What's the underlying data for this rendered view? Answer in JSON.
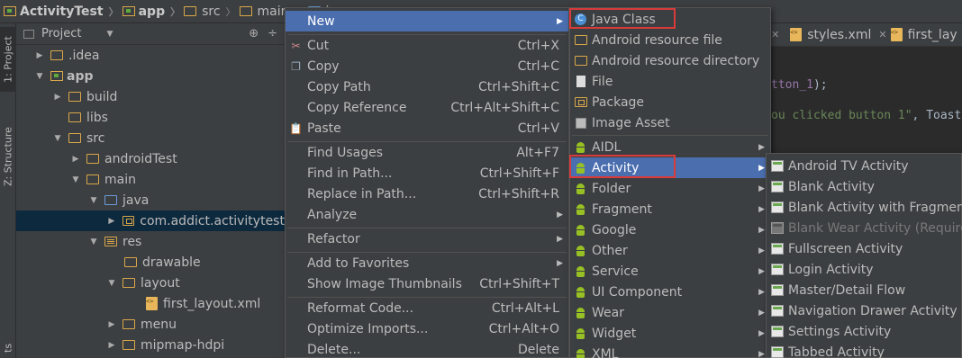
{
  "breadcrumb": [
    "ActivityTest",
    "app",
    "src",
    "main",
    "ja"
  ],
  "sidebar_tabs": {
    "project": "1: Project",
    "structure": "Z: Structure",
    "extra": "ts"
  },
  "project_panel": {
    "view_label": "Project",
    "tree": [
      {
        "label": ".idea"
      },
      {
        "label": "app"
      },
      {
        "label": "build"
      },
      {
        "label": "libs"
      },
      {
        "label": "src"
      },
      {
        "label": "androidTest"
      },
      {
        "label": "main"
      },
      {
        "label": "java"
      },
      {
        "label": "com.addict.activitytest"
      },
      {
        "label": "res"
      },
      {
        "label": "drawable"
      },
      {
        "label": "layout"
      },
      {
        "label": "first_layout.xml"
      },
      {
        "label": "menu"
      },
      {
        "label": "mipmap-hdpi"
      }
    ]
  },
  "editor": {
    "tabs": [
      "styles.xml",
      "first_lay"
    ],
    "code_line1": {
      "ident": "tton_1",
      "rest": ");"
    },
    "code_line2": {
      "str": "ou clicked button 1\"",
      "rest": ", Toast"
    }
  },
  "context_menu": {
    "items": [
      {
        "label": "New",
        "shortcut": ""
      },
      {
        "label": "Cut",
        "shortcut": "Ctrl+X"
      },
      {
        "label": "Copy",
        "shortcut": "Ctrl+C"
      },
      {
        "label": "Copy Path",
        "shortcut": "Ctrl+Shift+C"
      },
      {
        "label": "Copy Reference",
        "shortcut": "Ctrl+Alt+Shift+C"
      },
      {
        "label": "Paste",
        "shortcut": "Ctrl+V"
      },
      {
        "label": "Find Usages",
        "shortcut": "Alt+F7"
      },
      {
        "label": "Find in Path...",
        "shortcut": "Ctrl+Shift+F"
      },
      {
        "label": "Replace in Path...",
        "shortcut": "Ctrl+Shift+R"
      },
      {
        "label": "Analyze",
        "shortcut": ""
      },
      {
        "label": "Refactor",
        "shortcut": ""
      },
      {
        "label": "Add to Favorites",
        "shortcut": ""
      },
      {
        "label": "Show Image Thumbnails",
        "shortcut": "Ctrl+Shift+T"
      },
      {
        "label": "Reformat Code...",
        "shortcut": "Ctrl+Alt+L"
      },
      {
        "label": "Optimize Imports...",
        "shortcut": "Ctrl+Alt+O"
      },
      {
        "label": "Delete...",
        "shortcut": "Delete"
      }
    ]
  },
  "new_menu": {
    "items": [
      {
        "label": "Java Class"
      },
      {
        "label": "Android resource file"
      },
      {
        "label": "Android resource directory"
      },
      {
        "label": "File"
      },
      {
        "label": "Package"
      },
      {
        "label": "Image Asset"
      },
      {
        "label": "AIDL"
      },
      {
        "label": "Activity"
      },
      {
        "label": "Folder"
      },
      {
        "label": "Fragment"
      },
      {
        "label": "Google"
      },
      {
        "label": "Other"
      },
      {
        "label": "Service"
      },
      {
        "label": "UI Component"
      },
      {
        "label": "Wear"
      },
      {
        "label": "Widget"
      },
      {
        "label": "XML"
      }
    ]
  },
  "activity_menu": {
    "items": [
      {
        "label": "Android TV Activity"
      },
      {
        "label": "Blank Activity"
      },
      {
        "label": "Blank Activity with Fragment"
      },
      {
        "label": "Blank Wear Activity (Requires"
      },
      {
        "label": "Fullscreen Activity"
      },
      {
        "label": "Login Activity"
      },
      {
        "label": "Master/Detail Flow"
      },
      {
        "label": "Navigation Drawer Activity"
      },
      {
        "label": "Settings Activity"
      },
      {
        "label": "Tabbed Activity"
      }
    ]
  },
  "colors": {
    "highlight": "#4b6eaf",
    "callout": "#d93a3a",
    "panel": "#3c3f41"
  }
}
